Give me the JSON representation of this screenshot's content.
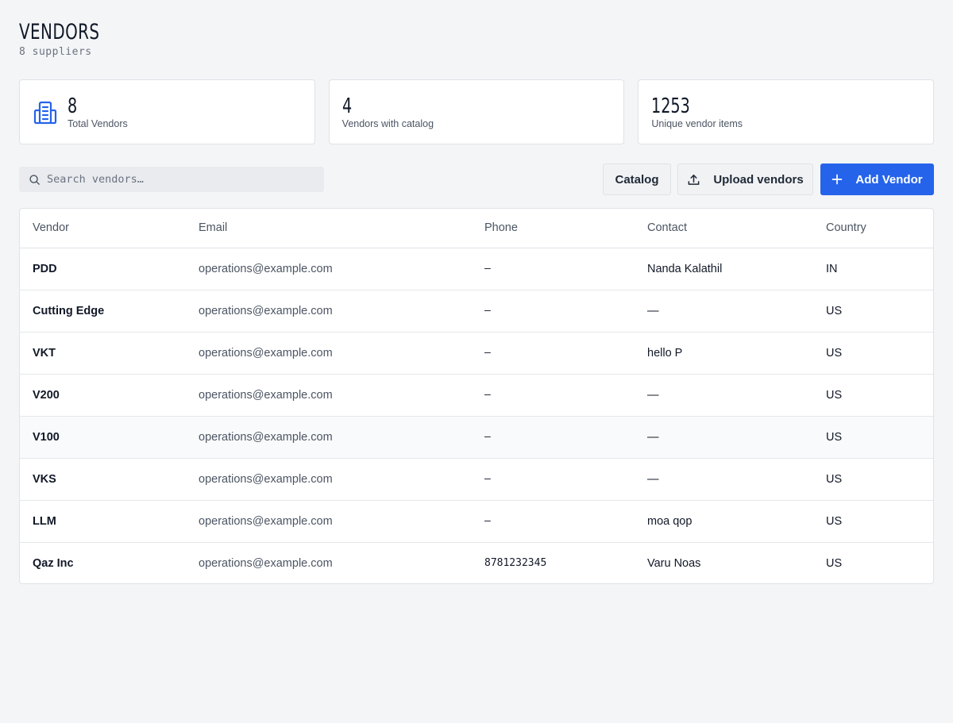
{
  "header": {
    "title": "VENDORS",
    "subtitle": "8 suppliers"
  },
  "stats": [
    {
      "value": "8",
      "label": "Total Vendors",
      "icon": "building-icon"
    },
    {
      "value": "4",
      "label": "Vendors with catalog"
    },
    {
      "value": "1253",
      "label": "Unique vendor items"
    }
  ],
  "toolbar": {
    "search_placeholder": "Search vendors…",
    "catalog_label": "Catalog",
    "upload_label": "Upload vendors",
    "add_label": "Add Vendor"
  },
  "colors": {
    "accent": "#2563eb",
    "background": "#f4f5f7"
  },
  "table": {
    "columns": [
      "Vendor",
      "Email",
      "Phone",
      "Contact",
      "Country"
    ],
    "rows": [
      {
        "vendor": "PDD",
        "email": "operations@example.com",
        "phone": "–",
        "contact": "Nanda Kalathil",
        "country": "IN"
      },
      {
        "vendor": "Cutting Edge",
        "email": "operations@example.com",
        "phone": "–",
        "contact": "—",
        "country": "US"
      },
      {
        "vendor": "VKT",
        "email": "operations@example.com",
        "phone": "–",
        "contact": "hello P",
        "country": "US"
      },
      {
        "vendor": "V200",
        "email": "operations@example.com",
        "phone": "–",
        "contact": "—",
        "country": "US"
      },
      {
        "vendor": "V100",
        "email": "operations@example.com",
        "phone": "–",
        "contact": "—",
        "country": "US"
      },
      {
        "vendor": "VKS",
        "email": "operations@example.com",
        "phone": "–",
        "contact": "—",
        "country": "US"
      },
      {
        "vendor": "LLM",
        "email": "operations@example.com",
        "phone": "–",
        "contact": "moa qop",
        "country": "US"
      },
      {
        "vendor": "Qaz Inc",
        "email": "operations@example.com",
        "phone": "8781232345",
        "contact": "Varu Noas",
        "country": "US"
      }
    ]
  }
}
